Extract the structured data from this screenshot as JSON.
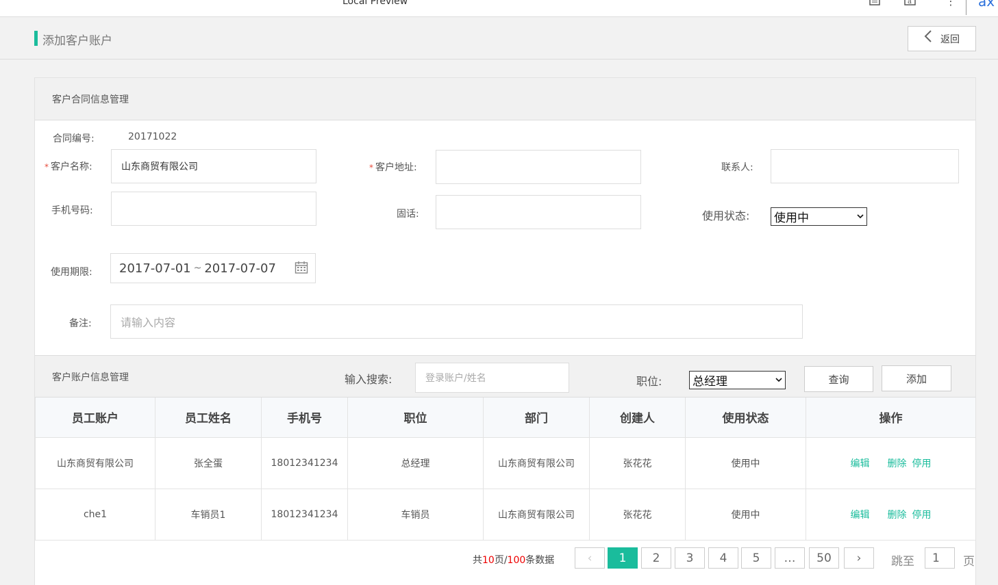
{
  "topbar": {
    "title": "Local Preview"
  },
  "header": {
    "title": "添加客户账户",
    "back_label": "返回"
  },
  "contract": {
    "section_title": "客户合同信息管理",
    "contract_no_label": "合同编号:",
    "contract_no_value": "20171022",
    "customer_name_label": "客户名称:",
    "customer_name_value": "山东商贸有限公司",
    "address_label": "客户地址:",
    "address_value": "",
    "contact_label": "联系人:",
    "contact_value": "",
    "mobile_label": "手机号码:",
    "mobile_value": "",
    "phone_label": "固话:",
    "phone_value": "",
    "status_label": "使用状态:",
    "status_value": "使用中",
    "period_label": "使用期限:",
    "period_start": "2017-07-01",
    "period_sep": "~",
    "period_end": "2017-07-07",
    "remark_label": "备注:",
    "remark_placeholder": "请输入内容"
  },
  "accounts": {
    "section_title": "客户账户信息管理",
    "search_label": "输入搜索:",
    "search_placeholder": "登录账户/姓名",
    "position_label": "职位:",
    "position_value": "总经理",
    "query_label": "查询",
    "add_label": "添加",
    "columns": [
      "员工账户",
      "员工姓名",
      "手机号",
      "职位",
      "部门",
      "创建人",
      "使用状态",
      "操作"
    ],
    "rows": [
      {
        "account": "山东商贸有限公司",
        "name": "张全蛋",
        "phone": "18012341234",
        "position": "总经理",
        "dept": "山东商贸有限公司",
        "creator": "张花花",
        "status": "使用中",
        "edit": "编辑",
        "del": "删除",
        "disable": "停用"
      },
      {
        "account": "che1",
        "name": "车销员1",
        "phone": "18012341234",
        "position": "车销员",
        "dept": "山东商贸有限公司",
        "creator": "张花花",
        "status": "使用中",
        "edit": "编辑",
        "del": "删除",
        "disable": "停用"
      }
    ]
  },
  "pagination": {
    "prefix": "共",
    "pages": "10",
    "mid": "页/",
    "records": "100",
    "suffix": "条数据",
    "prev": "‹",
    "next": "›",
    "items": [
      "1",
      "2",
      "3",
      "4",
      "5",
      "…",
      "50"
    ],
    "jump_label": "跳至",
    "jump_value": "1",
    "jump_unit": "页"
  }
}
